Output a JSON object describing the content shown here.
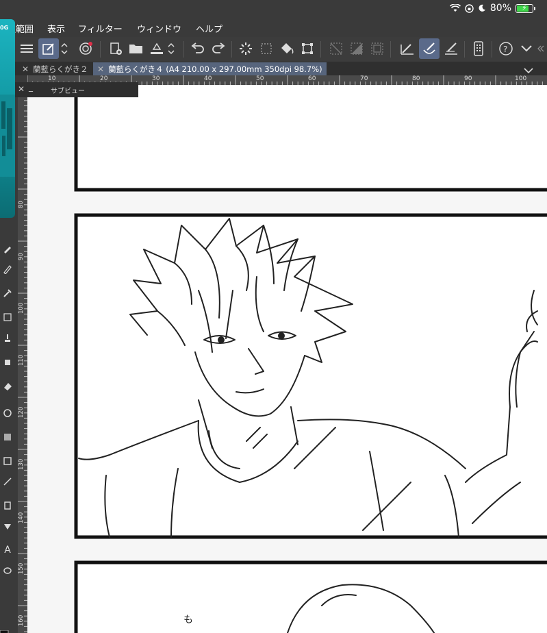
{
  "status": {
    "battery_text": "80%",
    "battery_level": 0.8,
    "battery_color": "#3fd64a"
  },
  "menu": {
    "items": [
      {
        "label": "択範囲"
      },
      {
        "label": "表示"
      },
      {
        "label": "フィルター"
      },
      {
        "label": "ウィンドウ"
      },
      {
        "label": "ヘルプ"
      }
    ]
  },
  "teal_app": {
    "label": "0G"
  },
  "tabs": [
    {
      "label": "蘭藍らくがき２",
      "active": false
    },
    {
      "label": "蘭藍らくがき４ (A4 210.00 x 297.00mm 350dpi 98.7%)",
      "active": true
    }
  ],
  "subview": {
    "title": "サブビュー"
  },
  "ruler": {
    "h_labels": [
      "10",
      "20",
      "30",
      "40",
      "50",
      "60",
      "70",
      "80",
      "90",
      "100"
    ],
    "v_labels": [
      "80",
      "90",
      "100",
      "110",
      "120",
      "130",
      "140",
      "150",
      "160"
    ]
  },
  "canvas": {
    "sfx_text": "も"
  },
  "colors": {
    "accent_active": "#57657d",
    "toolbar_bg": "#3c3c3c",
    "teal": "#1cb4c0"
  }
}
